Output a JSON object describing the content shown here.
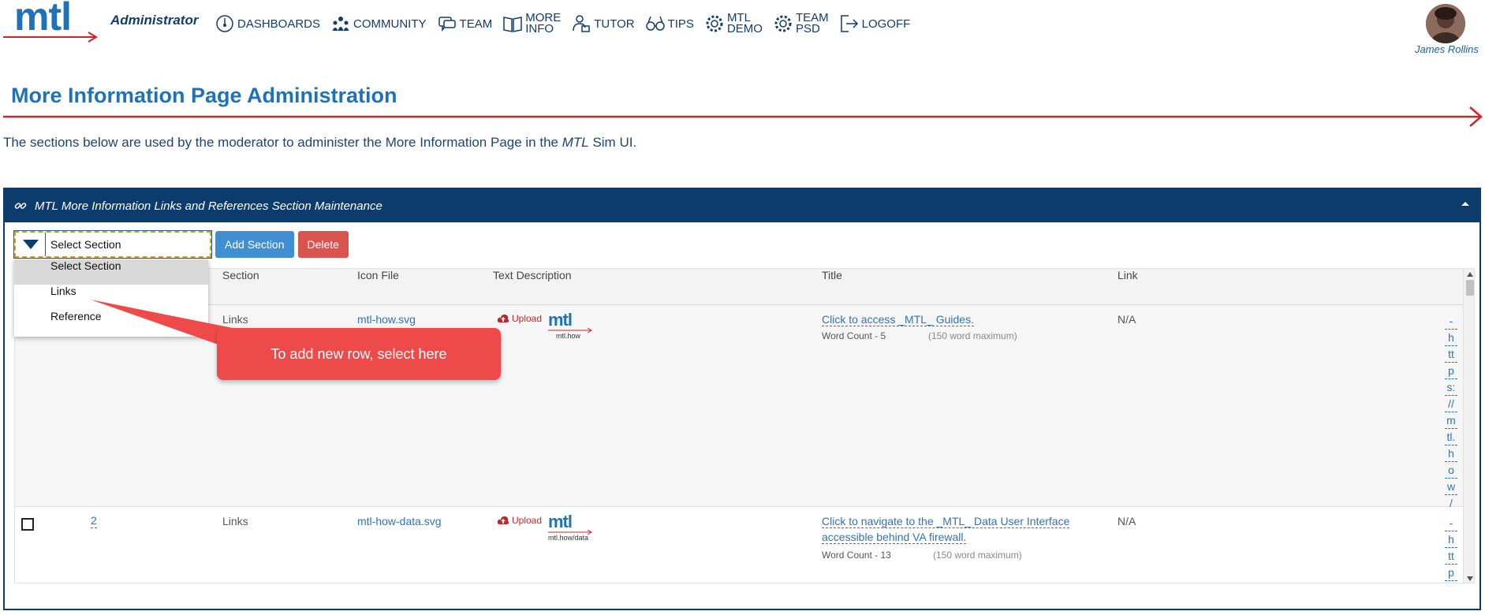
{
  "header": {
    "logo_text": "mtl",
    "role": "Administrator",
    "nav": [
      {
        "label": "DASHBOARDS",
        "icon": "dashboard-icon"
      },
      {
        "label": "COMMUNITY",
        "icon": "community-icon"
      },
      {
        "label": "TEAM",
        "icon": "team-chat-icon"
      },
      {
        "label": "MORE INFO",
        "icon": "book-icon"
      },
      {
        "label": "TUTOR",
        "icon": "tutor-icon"
      },
      {
        "label": "TIPS",
        "icon": "glasses-icon"
      },
      {
        "label": "MTL DEMO",
        "icon": "gear-icon"
      },
      {
        "label": "TEAM PSD",
        "icon": "gear-icon"
      },
      {
        "label": "LOGOFF",
        "icon": "logoff-icon"
      }
    ],
    "user_name": "James Rollins"
  },
  "page": {
    "title": "More Information Page Administration",
    "intro_before": "The sections below are used by the moderator to administer the More Information Page in the ",
    "intro_em": "MTL",
    "intro_after": " Sim UI."
  },
  "panel": {
    "title": "MTL More Information Links and References Section Maintenance",
    "select_value": "Select Section",
    "add_button": "Add Section",
    "delete_button": "Delete",
    "dropdown_options": [
      "Select Section",
      "Links",
      "Reference"
    ],
    "columns": [
      "Section",
      "Icon File",
      "Text Description",
      "Title",
      "Link"
    ],
    "rows": [
      {
        "id": "",
        "section": "Links",
        "icon_file": "mtl-how.svg",
        "upload_label": "Upload",
        "preview_caption": "mtl.how",
        "title": "Click to access _MTL_ Guides.",
        "word_count": "Word Count - 5",
        "word_max": "(150 word maximum)",
        "link": "N/A",
        "url_chars": [
          "-",
          "h",
          "tt",
          "p",
          "s:",
          "//",
          "m",
          "tl.",
          "h",
          "o",
          "w",
          "/"
        ]
      },
      {
        "id": "2",
        "section": "Links",
        "icon_file": "mtl-how-data.svg",
        "upload_label": "Upload",
        "preview_caption": "mtl.how/data",
        "title_line1": "Click to navigate to the _MTL_ Data User Interface",
        "title_line2": "accessible behind VA firewall.",
        "word_count": "Word Count - 13",
        "word_max": "(150 word maximum)",
        "link": "N/A",
        "url_chars": [
          "-",
          "h",
          "tt",
          "p"
        ]
      }
    ]
  },
  "callout": {
    "text": "To add new row, select here"
  },
  "colors": {
    "brand_blue": "#1e73b8",
    "navy": "#0c3b6e",
    "accent_red": "#d0232a",
    "callout_red": "#ef4a4a",
    "add_button": "#3f8fd2",
    "delete_button": "#d9534f"
  }
}
